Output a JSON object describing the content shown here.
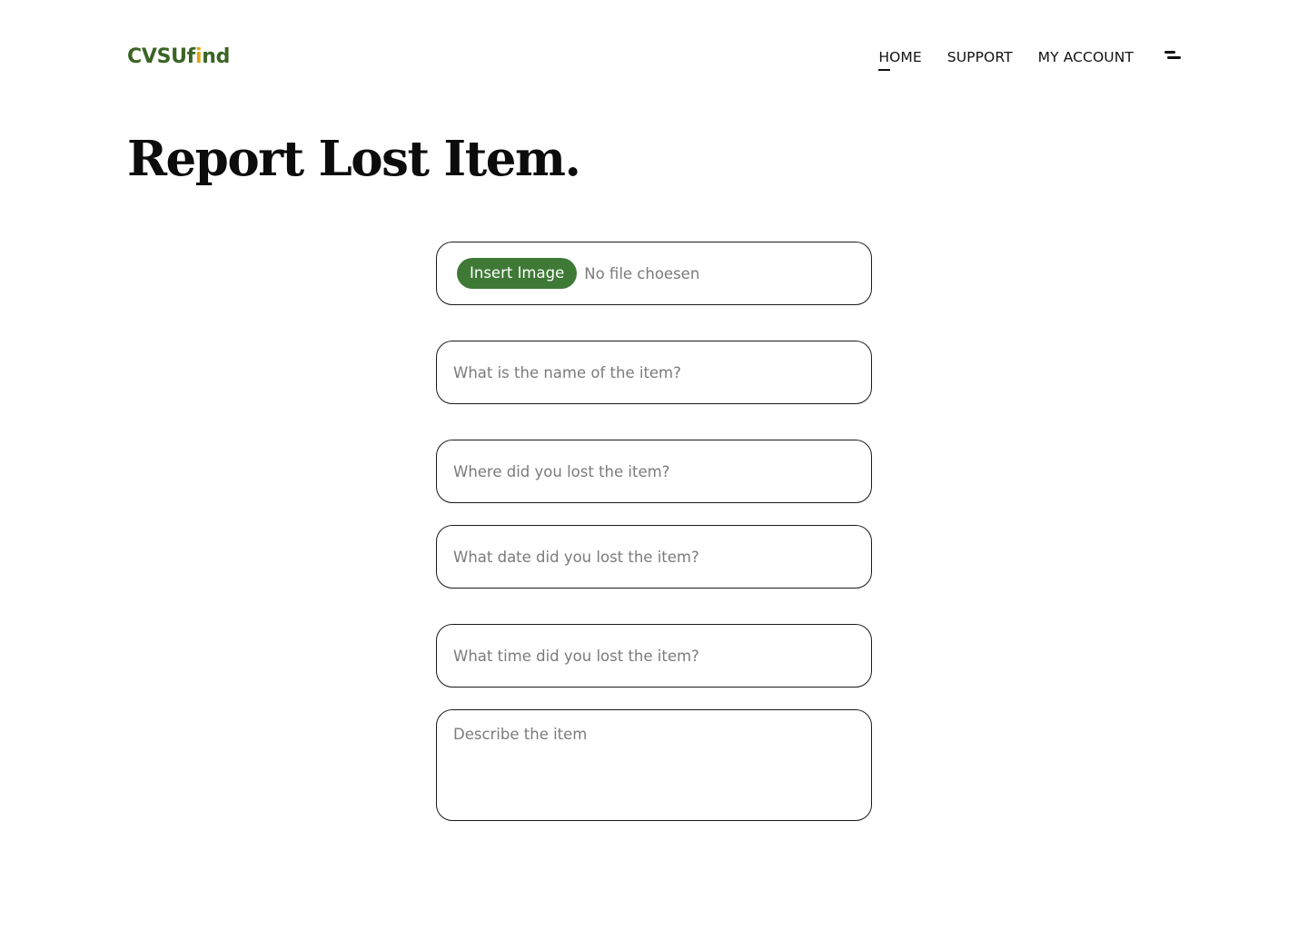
{
  "header": {
    "logo": {
      "part1": "CVSUf",
      "accent": "i",
      "part2": "nd"
    },
    "nav": [
      {
        "label": "HOME",
        "active": true
      },
      {
        "label": "SUPPORT",
        "active": false
      },
      {
        "label": "MY ACCOUNT",
        "active": false
      }
    ],
    "menu_icon": "menu-icon"
  },
  "page": {
    "title": "Report Lost Item."
  },
  "form": {
    "image_upload": {
      "button_label": "Insert Image",
      "status": "No file choesen"
    },
    "item_name": {
      "placeholder": "What is the name of the item?",
      "value": ""
    },
    "location": {
      "placeholder": "Where did you lost the item?",
      "value": ""
    },
    "date": {
      "placeholder": "What date did you lost the item?",
      "value": ""
    },
    "time": {
      "placeholder": "What time did you lost the item?",
      "value": ""
    },
    "description": {
      "placeholder": "Describe the item",
      "value": ""
    }
  },
  "colors": {
    "brand_green": "#3b6425",
    "brand_accent": "#e2a50f",
    "button_green": "#3e7a36"
  }
}
